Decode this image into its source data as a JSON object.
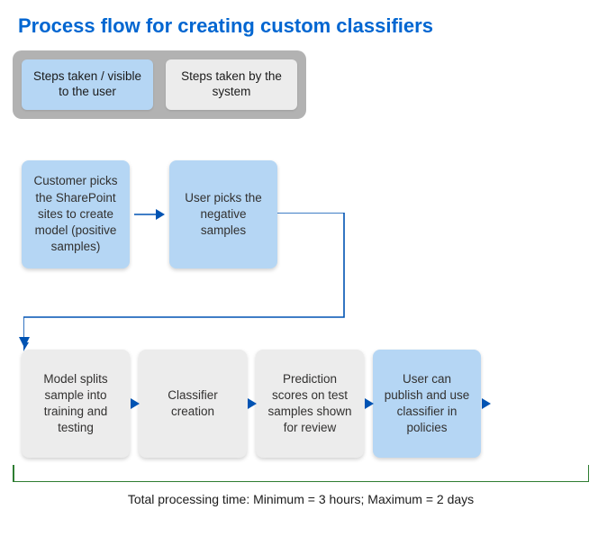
{
  "title": "Process flow for creating custom classifiers",
  "legend": {
    "user": "Steps taken / visible to the user",
    "system": "Steps taken by the system"
  },
  "row1": {
    "step1": "Customer picks the SharePoint sites to create model (positive samples)",
    "step2": "User picks the negative samples"
  },
  "row2": {
    "step3": "Model splits sample into training and testing",
    "step4": "Classifier creation",
    "step5": "Prediction scores on test samples shown for review",
    "step6": "User can publish and use classifier in policies"
  },
  "footer": "Total processing time: Minimum = 3 hours; Maximum = 2 days"
}
